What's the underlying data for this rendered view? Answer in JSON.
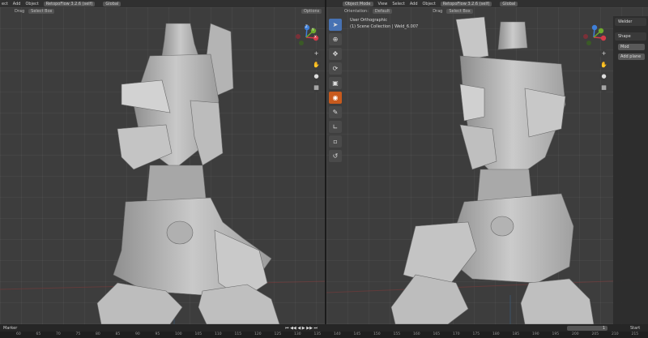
{
  "left_header": {
    "menus": [
      "ect",
      "Add",
      "Object"
    ],
    "addon_dropdown": "RetopoFlow 3.2.6 (self)",
    "transform_dropdown": "Global"
  },
  "left_subheader": {
    "drag_label": "Drag",
    "select_box": "Select Box",
    "options_label": "Options"
  },
  "right_header": {
    "mode_dropdown": "Object Mode",
    "menus": [
      "View",
      "Select",
      "Add",
      "Object"
    ],
    "addon_dropdown": "RetopoFlow 3.2.6 (self)",
    "transform_dropdown": "Global"
  },
  "right_subheader": {
    "orientation_label": "Orientation:",
    "orientation_value": "Default",
    "drag_label": "Drag",
    "select_box": "Select Box"
  },
  "viewport_right": {
    "view_name": "User Orthographic",
    "collection_line": "(1) Scene Collection | Weld_6.007"
  },
  "gizmo": {
    "x": "X",
    "y": "Y",
    "z": "Z"
  },
  "side_panel": {
    "tab_weld": "Welder",
    "tab_shape": "Shape",
    "button_mod": "Mod",
    "button_add": "Add plane"
  },
  "timeline": {
    "marker_label": "Marker",
    "frame_current": "1",
    "start_label": "Start",
    "ruler": [
      "60",
      "65",
      "70",
      "75",
      "80",
      "85",
      "90",
      "95",
      "100",
      "105",
      "110",
      "115",
      "120",
      "125",
      "130",
      "135",
      "140",
      "145",
      "150",
      "155",
      "160",
      "165",
      "170",
      "175",
      "180",
      "185",
      "190",
      "195",
      "200",
      "205",
      "210",
      "215"
    ]
  },
  "colors": {
    "x_axis": "#d53b4a",
    "y_axis": "#6ea92d",
    "z_axis": "#3f7fd8",
    "accent": "#4772b3",
    "active_tool": "#c85a1d"
  }
}
